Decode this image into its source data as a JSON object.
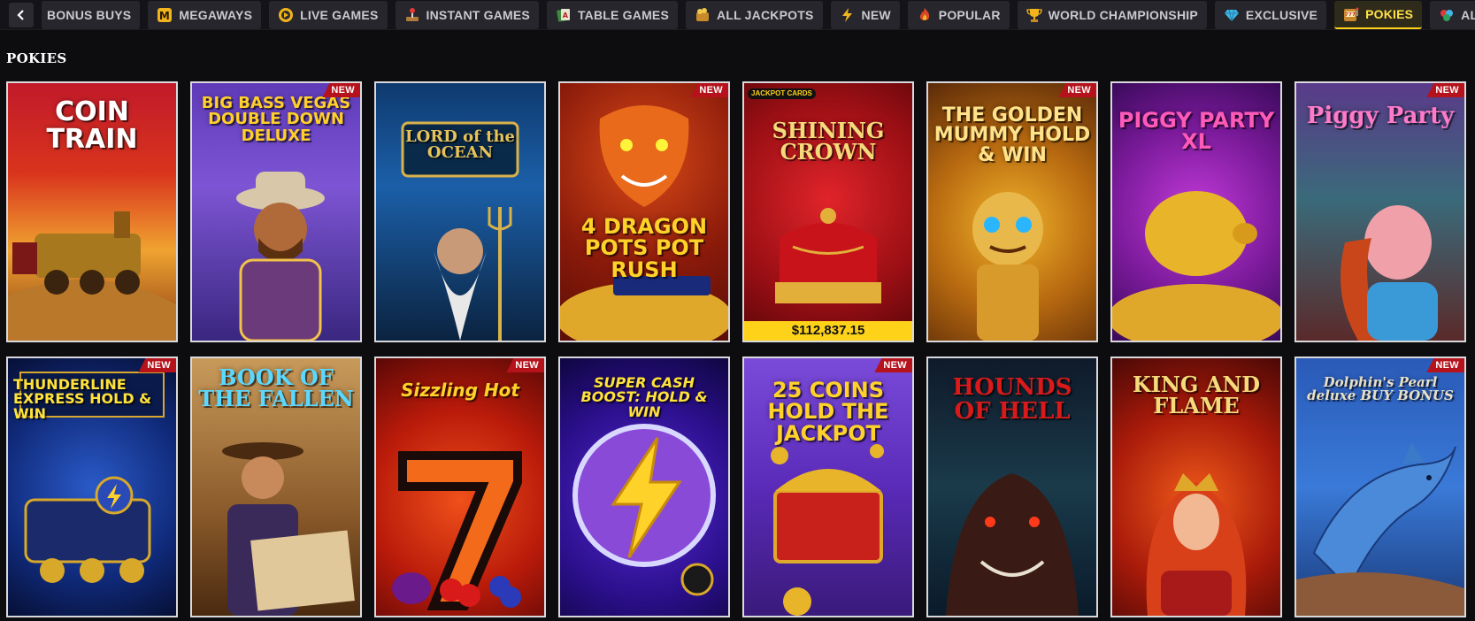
{
  "nav": {
    "tabs": [
      {
        "label": "BONUS BUYS",
        "icon": "bonus-buys-icon"
      },
      {
        "label": "MEGAWAYS",
        "icon": "megaways-icon"
      },
      {
        "label": "LIVE GAMES",
        "icon": "live-games-icon"
      },
      {
        "label": "INSTANT GAMES",
        "icon": "instant-games-icon"
      },
      {
        "label": "TABLE GAMES",
        "icon": "table-games-icon"
      },
      {
        "label": "ALL JACKPOTS",
        "icon": "jackpot-icon"
      },
      {
        "label": "NEW",
        "icon": "lightning-icon"
      },
      {
        "label": "POPULAR",
        "icon": "fire-icon"
      },
      {
        "label": "WORLD CHAMPIONSHIP",
        "icon": "trophy-icon"
      },
      {
        "label": "EXCLUSIVE",
        "icon": "diamond-icon"
      },
      {
        "label": "POKIES",
        "icon": "slot-machine-icon",
        "active": true
      },
      {
        "label": "ALL GAMES",
        "icon": "gems-icon"
      }
    ]
  },
  "section": {
    "title": "POKIES"
  },
  "badge_label": "NEW",
  "games": [
    {
      "title": "COIN TRAIN",
      "new": false
    },
    {
      "title": "BIG BASS VEGAS DOUBLE DOWN DELUXE",
      "new": true
    },
    {
      "title": "LORD of the OCEAN",
      "new": false
    },
    {
      "title": "4 DRAGON POTS POT RUSH",
      "new": true
    },
    {
      "title": "SHINING CROWN",
      "new": false,
      "jackpot_tag": "JACKPOT CARDS",
      "jackpot": "$112,837.15"
    },
    {
      "title": "THE GOLDEN MUMMY HOLD & WIN",
      "new": true
    },
    {
      "title": "PIGGY PARTY XL",
      "new": false
    },
    {
      "title": "Piggy Party",
      "new": true
    },
    {
      "title": "THUNDERLINE EXPRESS HOLD & WIN",
      "new": true
    },
    {
      "title": "BOOK OF THE FALLEN",
      "new": false
    },
    {
      "title": "Sizzling Hot",
      "new": true
    },
    {
      "title": "SUPER CASH BOOST: HOLD & WIN",
      "new": false
    },
    {
      "title": "25 COINS HOLD THE JACKPOT",
      "new": true
    },
    {
      "title": "HOUNDS OF HELL",
      "new": false
    },
    {
      "title": "KING AND FLAME",
      "new": false
    },
    {
      "title": "Dolphin's Pearl deluxe BUY BONUS",
      "new": true
    }
  ],
  "colors": {
    "background": "#0d0d10",
    "tab_bg": "#26262c",
    "active_tab": "#ffd21a",
    "new_badge": "#b5121b",
    "jackpot_bar": "#ffd21a"
  }
}
